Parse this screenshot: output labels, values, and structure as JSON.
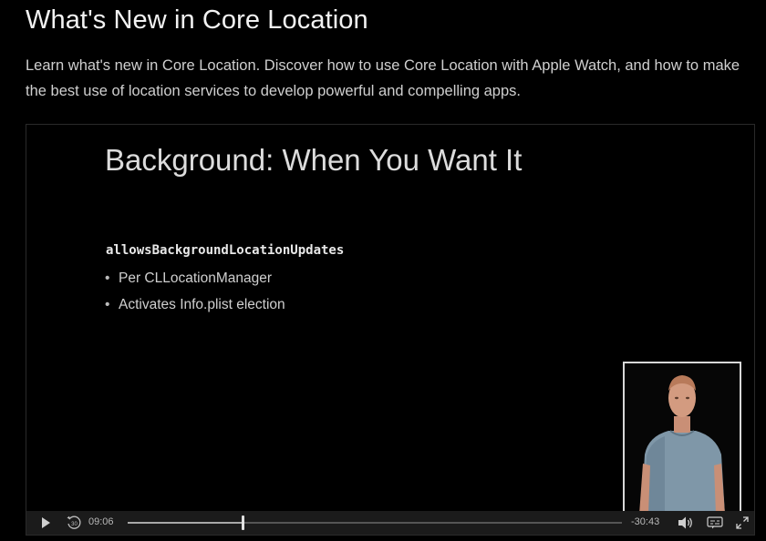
{
  "page": {
    "title": "What's New in Core Location",
    "description": "Learn what's new in Core Location. Discover how to use Core Location with Apple Watch, and how to make the best use of location services to develop powerful and compelling apps."
  },
  "slide": {
    "title": "Background: When You Want It",
    "code": "allowsBackgroundLocationUpdates",
    "bullets": [
      "Per CLLocationManager",
      "Activates Info.plist election"
    ],
    "bullet_glyph": "•"
  },
  "player": {
    "elapsed": "09:06",
    "remaining": "-30:43",
    "progress": 0.233,
    "skip_back_label": "30",
    "icons": [
      "play-icon",
      "skip-back-30-icon",
      "volume-icon",
      "captions-icon",
      "fullscreen-icon"
    ],
    "colors": {
      "track": "#555555",
      "played": "#a8a8a8",
      "controls_bg": "#1b1b1b"
    }
  }
}
